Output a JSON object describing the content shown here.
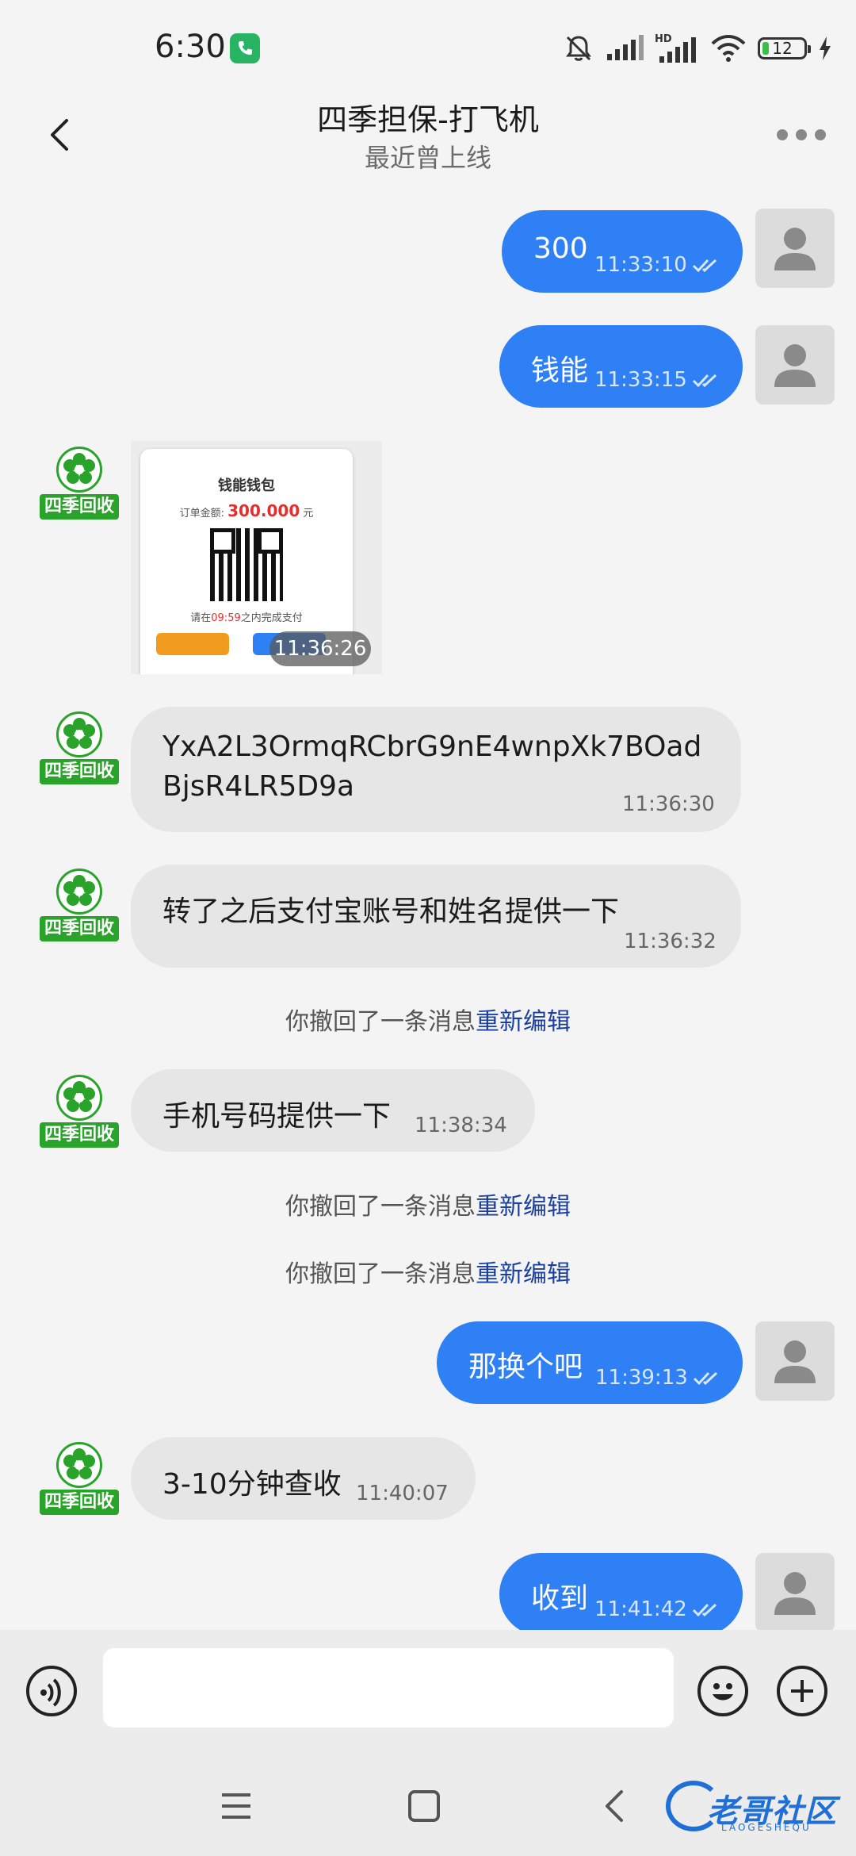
{
  "status_bar": {
    "time": "6:30",
    "battery": "12"
  },
  "header": {
    "title": "四季担保-打飞机",
    "subtitle": "最近曾上线"
  },
  "contact": {
    "logo_text": "四季回收"
  },
  "messages": [
    {
      "dir": "out",
      "text": "300",
      "time": "11:33:10"
    },
    {
      "dir": "out",
      "text": "钱能",
      "time": "11:33:15"
    },
    {
      "dir": "in",
      "type": "image",
      "time": "11:36:26",
      "image": {
        "title": "钱能钱包",
        "amount_label": "订单金额:",
        "amount": "300.000",
        "amount_unit": "元",
        "timer_prefix": "请在",
        "timer": "09:59",
        "timer_suffix": "之内完成支付"
      }
    },
    {
      "dir": "in",
      "text_line1": "YxA2L3OrmqRCbrG9nE4wnpXk7BOad",
      "text_line2": "BjsR4LR5D9a",
      "time": "11:36:30"
    },
    {
      "dir": "in",
      "text": "转了之后支付宝账号和姓名提供一下",
      "time": "11:36:32"
    },
    {
      "dir": "system",
      "text": "你撤回了一条消息",
      "link": "重新编辑"
    },
    {
      "dir": "in",
      "text": "手机号码提供一下",
      "time": "11:38:34"
    },
    {
      "dir": "system",
      "text": "你撤回了一条消息",
      "link": "重新编辑"
    },
    {
      "dir": "system",
      "text": "你撤回了一条消息",
      "link": "重新编辑"
    },
    {
      "dir": "out",
      "text": "那换个吧",
      "time": "11:39:13"
    },
    {
      "dir": "in",
      "text": "3-10分钟查收",
      "time": "11:40:07"
    },
    {
      "dir": "out",
      "text": "收到",
      "time": "11:41:42"
    }
  ],
  "input": {
    "placeholder": ""
  },
  "watermark": {
    "text": "老哥社区",
    "sub": "LAOGESHEQU"
  },
  "colors": {
    "outgoing_bubble": "#2f80f5",
    "incoming_bubble": "#e6e6e6",
    "logo_green": "#29a32a",
    "link": "#1a3fa0"
  },
  "icons": [
    "phone-icon",
    "mute-icon",
    "signal-icon",
    "wifi-icon",
    "battery-icon",
    "charging-icon",
    "back-arrow-icon",
    "more-icon",
    "person-icon",
    "flower-logo-icon",
    "double-check-icon",
    "voice-icon",
    "emoji-icon",
    "plus-icon",
    "menu-icon",
    "home-icon",
    "back-icon"
  ]
}
